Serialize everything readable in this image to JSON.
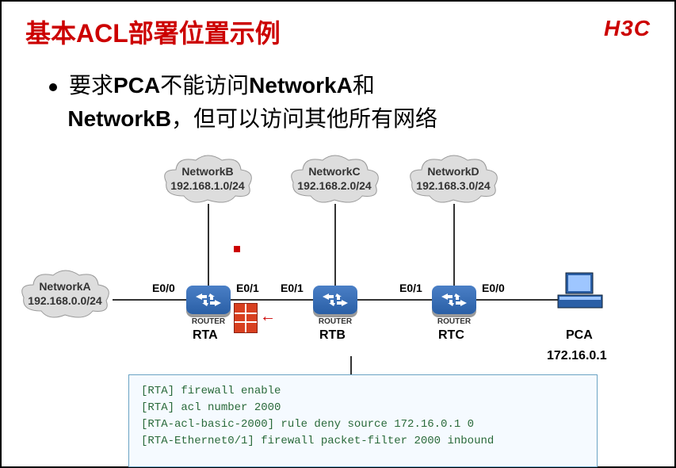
{
  "title": "基本ACL部署位置示例",
  "logo": "H3C",
  "bullet": {
    "prefix": "要求",
    "pca": "PCA",
    "mid1": "不能访问",
    "netA": "NetworkA",
    "and": "和",
    "netB": "NetworkB",
    "tail": "，但可以访问其他所有网络"
  },
  "networks": {
    "A": {
      "name": "NetworkA",
      "cidr": "192.168.0.0/24"
    },
    "B": {
      "name": "NetworkB",
      "cidr": "192.168.1.0/24"
    },
    "C": {
      "name": "NetworkC",
      "cidr": "192.168.2.0/24"
    },
    "D": {
      "name": "NetworkD",
      "cidr": "192.168.3.0/24"
    }
  },
  "routers": {
    "rta": "RTA",
    "rtb": "RTB",
    "rtc": "RTC",
    "tag": "ROUTER"
  },
  "interfaces": {
    "rta_left": "E0/0",
    "rta_right": "E0/1",
    "rtb_left": "E0/1",
    "rtc_left": "E0/1",
    "rtc_right": "E0/0"
  },
  "pc": {
    "name": "PCA",
    "ip": "172.16.0.1"
  },
  "code": "[RTA] firewall enable\n[RTA] acl number 2000\n[RTA-acl-basic-2000] rule deny source 172.16.0.1 0\n[RTA-Ethernet0/1] firewall packet-filter 2000 inbound"
}
